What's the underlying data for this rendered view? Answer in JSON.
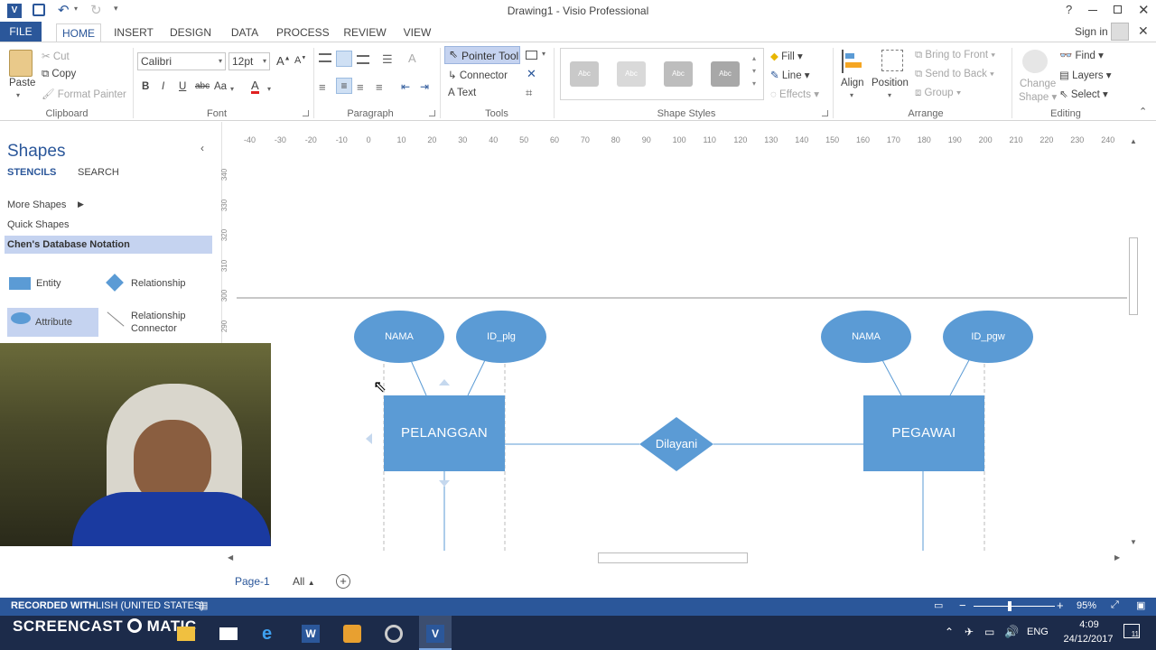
{
  "window": {
    "title": "Drawing1 - Visio Professional",
    "user": "Sign in",
    "help": "?"
  },
  "tabs": [
    "FILE",
    "HOME",
    "INSERT",
    "DESIGN",
    "DATA",
    "PROCESS",
    "REVIEW",
    "VIEW"
  ],
  "active_tab": "HOME",
  "ribbon": {
    "clipboard": {
      "paste": "Paste",
      "cut": "Cut",
      "copy": "Copy",
      "format_painter": "Format Painter",
      "label": "Clipboard"
    },
    "font": {
      "family": "Calibri",
      "size": "12pt",
      "bold": "B",
      "italic": "I",
      "underline": "U",
      "strike": "abc",
      "case": "Aa",
      "label": "Font"
    },
    "paragraph": {
      "label": "Paragraph"
    },
    "tools": {
      "pointer": "Pointer Tool",
      "connector": "Connector",
      "text": "Text",
      "text_glyph": "A",
      "label": "Tools"
    },
    "shape_styles": {
      "swatch": "Abc",
      "fill": "Fill",
      "line": "Line",
      "effects": "Effects",
      "label": "Shape Styles"
    },
    "arrange": {
      "align": "Align",
      "position": "Position",
      "bring_front": "Bring to Front",
      "send_back": "Send to Back",
      "group": "Group",
      "label": "Arrange"
    },
    "editing": {
      "change_shape_1": "Change",
      "change_shape_2": "Shape",
      "find": "Find",
      "layers": "Layers",
      "select": "Select",
      "label": "Editing"
    }
  },
  "shapes_panel": {
    "title": "Shapes",
    "tab_stencils": "STENCILS",
    "tab_search": "SEARCH",
    "more_shapes": "More Shapes",
    "quick_shapes": "Quick Shapes",
    "selected_stencil": "Chen's Database Notation",
    "items": [
      {
        "label": "Entity"
      },
      {
        "label": "Relationship"
      },
      {
        "label": "Attribute"
      },
      {
        "label": "Relationship Connector"
      }
    ]
  },
  "ruler_h": [
    "-40",
    "-30",
    "-20",
    "-10",
    "0",
    "10",
    "20",
    "30",
    "40",
    "50",
    "60",
    "70",
    "80",
    "90",
    "100",
    "110",
    "120",
    "130",
    "140",
    "150",
    "160",
    "170",
    "180",
    "190",
    "200",
    "210",
    "220",
    "230",
    "240"
  ],
  "ruler_v": [
    "340",
    "330",
    "320",
    "310",
    "300",
    "290"
  ],
  "diagram": {
    "entities": [
      "PELANGGAN",
      "PEGAWAI"
    ],
    "relationship": "Dilayani",
    "attributes_left": [
      "NAMA",
      "ID_plg"
    ],
    "attributes_right": [
      "NAMA",
      "ID_pgw"
    ]
  },
  "pages": {
    "current": "Page-1",
    "all": "All"
  },
  "status": {
    "watermark_top": "RECORDED WITH",
    "language": "LISH (UNITED STATES)",
    "zoom": "95%",
    "watermark_brand_left": "SCREENCAST",
    "watermark_brand_right": "MATIC"
  },
  "taskbar": {
    "lang": "ENG",
    "time": "4:09",
    "date": "24/12/2017",
    "notif": "11"
  },
  "colors": {
    "accent": "#2b579a",
    "shape": "#5b9bd5",
    "stencil_sel": "#c5d3f0"
  }
}
